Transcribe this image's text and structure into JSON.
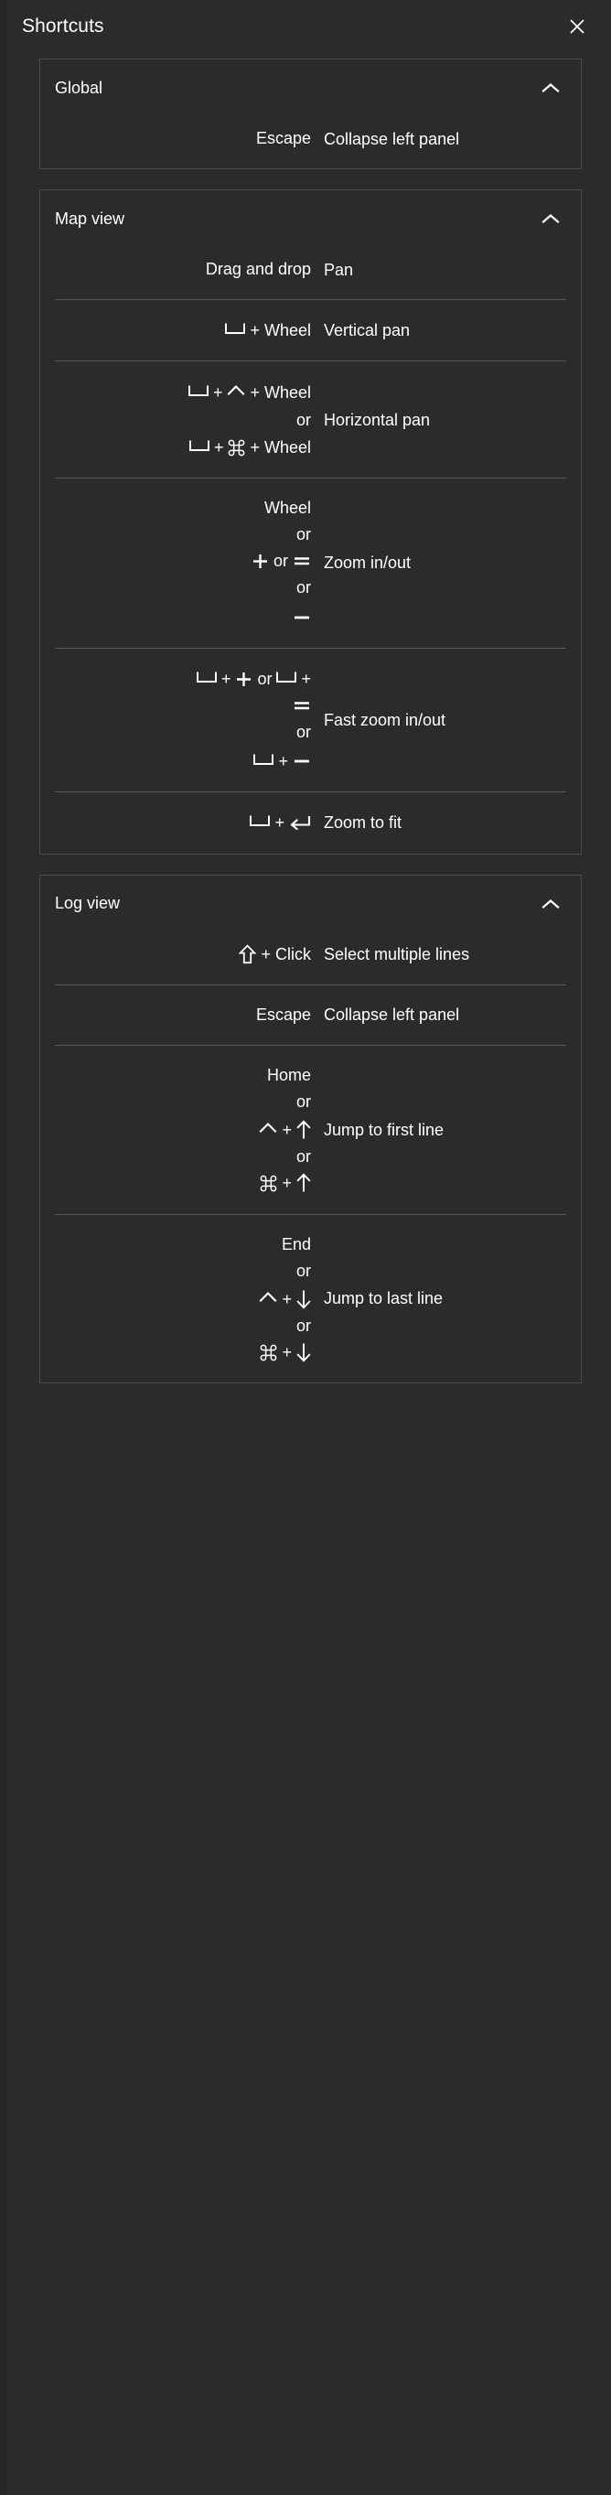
{
  "header": {
    "title": "Shortcuts",
    "close_icon": "close-icon"
  },
  "sections": [
    {
      "id": "global",
      "title": "Global",
      "collapse_icon": "chevron-up-icon",
      "rows": [
        {
          "keys_text": "Escape",
          "description": "Collapse left panel"
        }
      ]
    },
    {
      "id": "map-view",
      "title": "Map view",
      "collapse_icon": "chevron-up-icon",
      "rows": [
        {
          "keys_text": "Drag and drop",
          "description": "Pan"
        },
        {
          "keys_text": "␣ + Wheel",
          "description": "Vertical pan"
        },
        {
          "keys_text": "␣ + ^ + Wheel or ␣ + ⌘ + Wheel",
          "description": "Horizontal pan"
        },
        {
          "keys_text": "Wheel or + or = or −",
          "description": "Zoom in/out"
        },
        {
          "keys_text": "␣ + + or ␣ + = or ␣ + −",
          "description": "Fast zoom in/out"
        },
        {
          "keys_text": "␣ + ↵",
          "description": "Zoom to fit"
        }
      ]
    },
    {
      "id": "log-view",
      "title": "Log view",
      "collapse_icon": "chevron-up-icon",
      "rows": [
        {
          "keys_text": "⇧ + Click",
          "description": "Select multiple lines"
        },
        {
          "keys_text": "Escape",
          "description": "Collapse left panel"
        },
        {
          "keys_text": "Home or ^ + ↑ or ⌘ + ↑",
          "description": "Jump to first line"
        },
        {
          "keys_text": "End or ^ + ↓ or ⌘ + ↓",
          "description": "Jump to last line"
        }
      ]
    }
  ],
  "labels": {
    "or": "or",
    "plus": "+",
    "wheel": "Wheel",
    "click": "Click",
    "escape": "Escape",
    "drag_and_drop": "Drag and drop",
    "home": "Home",
    "end": "End"
  },
  "colors": {
    "panel_bg": "#2b2b2b",
    "page_bg": "#262626",
    "card_border": "#4a4a4a",
    "row_divider": "#575757",
    "text": "#ffffff"
  }
}
